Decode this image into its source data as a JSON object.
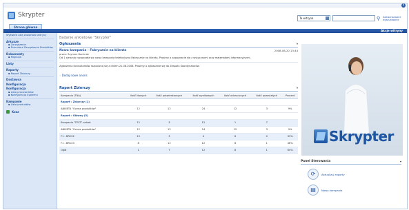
{
  "header": {
    "logo_text": "Skrypter",
    "search_scope": "Ta witryna",
    "search_placeholder": "",
    "advanced_search": "Zaawansowane wyszukiwanie",
    "tab_home": "Strona główna",
    "site_actions": "Akcje witryny"
  },
  "leftnav": {
    "top_links": [
      "Wyświetl całą zawartość witryny"
    ],
    "sections": [
      {
        "head": "Arkusze",
        "items": [
          "Zarządzenie",
          "Formularz Zarządzenia Produktów"
        ]
      },
      {
        "head": "Dokumenty",
        "items": [
          "Migracja"
        ]
      },
      {
        "head": "Listy",
        "items": []
      },
      {
        "head": "Raporty",
        "items": [
          "Raport Zbiorczy"
        ]
      },
      {
        "head": "Dostawca",
        "items": []
      },
      {
        "head": "Konfiguracja",
        "items": []
      },
      {
        "head": "Konfiguracja",
        "items": [
          "Lista pracowników",
          "Konfiguracja Systemu"
        ]
      },
      {
        "head": "Kampanie",
        "items": [
          "Lista produktów"
        ]
      }
    ],
    "recycle_bin": "Kosz"
  },
  "main": {
    "page_title": "Badanie ankietowe \"Skrypter\"",
    "announcements_title": "Ogłoszenia",
    "announcement": {
      "title": "Nowa kampania - Fabrycznie na klienta",
      "date": "2008-08-20 13:44",
      "author": "przez: Szymon Bochnak",
      "body": "Od 1 sierpnia rozpoczęła się nowa kampania telefoniczna Fabrycznie na klienta. Prosimy o zapoznanie się z wytycznymi oraz materiałami informacyjnymi.",
      "body2": "Zgłoszenia konsultantów rozpoczną się z dniem 21.08.2008. Prosimy o zgłaszanie się do Zespołu Koordynatorów."
    },
    "add_link": "Dodaj nowe anons",
    "report_title": "Raport Zbiorczy",
    "report_columns": [
      "Kampania (TNA)",
      "Ilość Nowych",
      "Ilość potwierdzonych",
      "Ilość wynikowych",
      "Ilość odrzuconych",
      "Ilość pozostałych",
      "Procent"
    ],
    "groups": [
      {
        "label": "Raport : Zbiorczy (1)",
        "rows": [
          [
            "ANKIETA \"Ocena produktów\"",
            "12",
            "12",
            "24",
            "12",
            "3",
            "9%"
          ]
        ]
      },
      {
        "label": "Raport : Główny (5)",
        "rows": [
          [
            "Kampania \"TEST\" ankiet",
            "12",
            "3",
            "12",
            "1",
            "7",
            ""
          ],
          [
            "ANKIETA \"Ocena produktów\"",
            "12",
            "12",
            "24",
            "12",
            "3",
            "9%"
          ],
          [
            "F1 - BRC22",
            "15",
            "3",
            "4",
            "6",
            "0",
            "33%"
          ],
          [
            "F1 - BRC23",
            "8",
            "12",
            "12",
            "8",
            "1",
            "46%"
          ],
          [
            "Ogół",
            "1",
            "7",
            "12",
            "8",
            "1",
            "64%"
          ]
        ]
      }
    ]
  },
  "right": {
    "brand_text": "Skrypter",
    "panel_title": "Panel Sterowania",
    "items": [
      "Aktualizuj raporty",
      "Nowa kampania"
    ]
  }
}
